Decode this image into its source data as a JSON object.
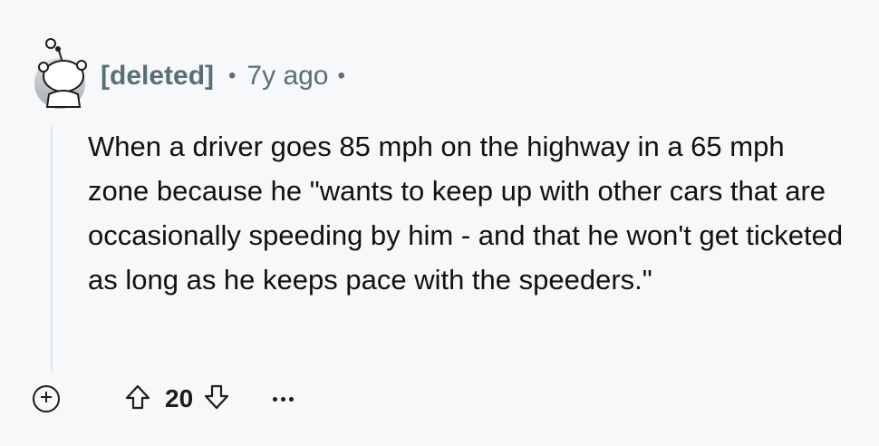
{
  "comment": {
    "author": "[deleted]",
    "separator": "•",
    "age": "7y ago",
    "body": "When a driver goes 85 mph on the highway in a 65 mph zone because he \"wants to keep up with other cars that are occasionally speeding by him - and that he won't get ticketed as long as he keeps pace with the speeders.\"",
    "score": "20"
  },
  "icons": {
    "avatar": "deleted-user-snoo-avatar",
    "expand": "plus-circle-icon",
    "upvote": "arrow-up-outline-icon",
    "downvote": "arrow-down-outline-icon",
    "more": "ellipsis-icon"
  }
}
